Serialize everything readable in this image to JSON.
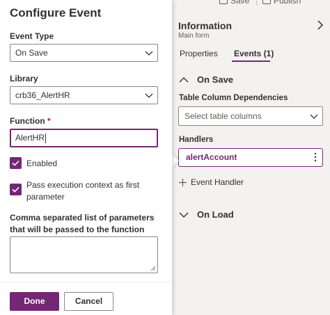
{
  "toolbar": {
    "save_label": "Save",
    "publish_label": "Publish"
  },
  "dialog": {
    "title": "Configure Event",
    "event_type": {
      "label": "Event Type",
      "value": "On Save"
    },
    "library": {
      "label": "Library",
      "value": "crb36_AlertHR"
    },
    "function": {
      "label": "Function",
      "required_mark": "*",
      "value": "AlertHR"
    },
    "enabled": {
      "label": "Enabled",
      "checked": true
    },
    "pass_context": {
      "label": "Pass execution context as first parameter",
      "checked": true
    },
    "parameters": {
      "label": "Comma separated list of parameters that will be passed to the function",
      "value": ""
    },
    "done_label": "Done",
    "cancel_label": "Cancel"
  },
  "panel": {
    "title": "Information",
    "subtitle": "Main form",
    "tabs": [
      {
        "label": "Properties",
        "selected": false
      },
      {
        "label": "Events (1)",
        "selected": true
      }
    ],
    "on_save": {
      "label": "On Save",
      "dependencies_label": "Table Column Dependencies",
      "dependencies_placeholder": "Select table columns",
      "handlers_label": "Handlers",
      "handlers": [
        "alertAccount"
      ],
      "add_handler_label": "Event Handler"
    },
    "on_load": {
      "label": "On Load"
    }
  },
  "colors": {
    "accent": "#742774",
    "text": "#323130",
    "panel_bg": "#f3f2f1"
  }
}
